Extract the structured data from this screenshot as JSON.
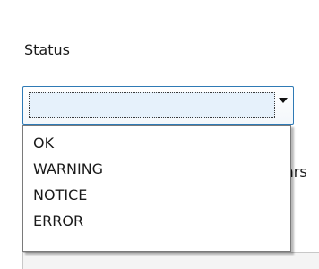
{
  "header": {
    "partial_title": "..."
  },
  "status": {
    "label": "Status",
    "selected_value": "",
    "options": [
      "OK",
      "WARNING",
      "NOTICE",
      "ERROR"
    ]
  },
  "background": {
    "partial_text": "ars"
  },
  "icons": {
    "dropdown_arrow": "chevron-down-icon"
  },
  "colors": {
    "combo_border": "#2f7ab5",
    "combo_fill": "#e6f1fb",
    "list_border": "#7a7a7a"
  }
}
